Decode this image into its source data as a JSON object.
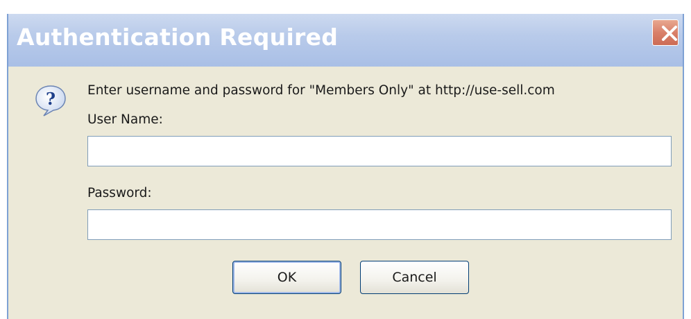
{
  "dialog": {
    "title": "Authentication Required",
    "prompt": "Enter username and password for \"Members Only\" at http://use-sell.com",
    "username_label": "User Name:",
    "username_value": "",
    "password_label": "Password:",
    "password_value": "",
    "ok_label": "OK",
    "cancel_label": "Cancel",
    "close_icon": "close-icon",
    "help_icon": "question-mark-icon"
  },
  "colors": {
    "title_bar": "#b9cbea",
    "dialog_body": "#ece9d8",
    "close_button": "#d9806a",
    "field_border": "#7f9db9",
    "button_border": "#003c74"
  }
}
